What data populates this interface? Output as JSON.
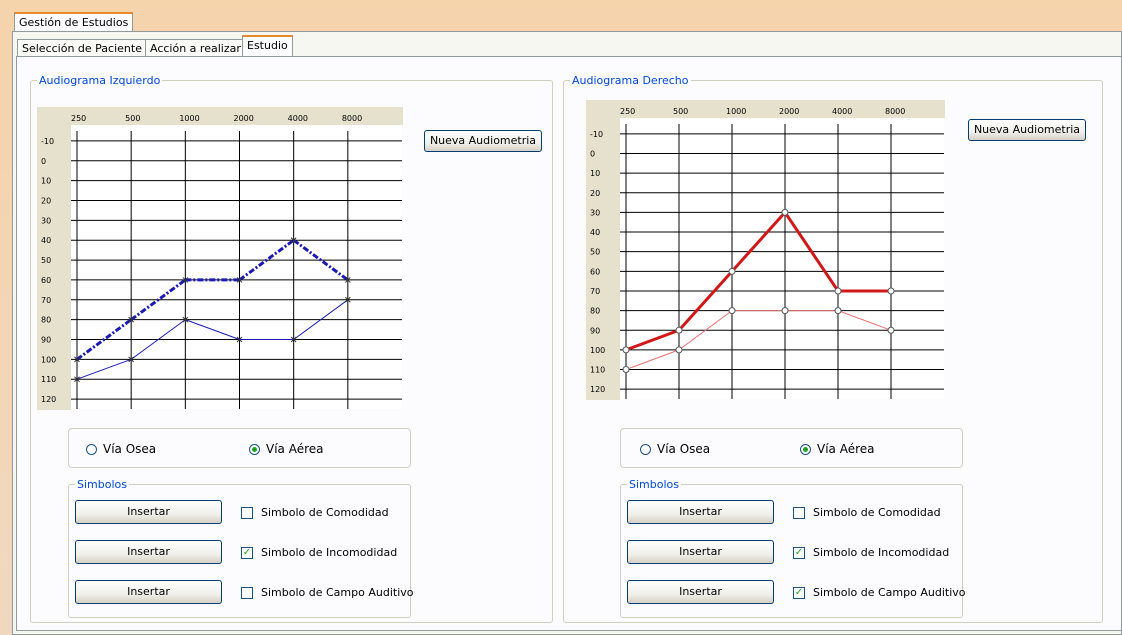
{
  "window": {
    "title": "Gestión de Estudios"
  },
  "tabs": [
    {
      "label": "Selección de Paciente"
    },
    {
      "label": "Acción a realizar"
    },
    {
      "label": "Estudio",
      "active": true
    }
  ],
  "left": {
    "group_title": "Audiograma Izquierdo",
    "new_button": "Nueva Audiometria",
    "radio_osea": "Vía Osea",
    "radio_aerea": "Vía Aérea",
    "selected_via": "aerea",
    "symbols_title": "Simbolos",
    "symbols": [
      {
        "button": "Insertar",
        "label": "Simbolo de Comodidad",
        "checked": false
      },
      {
        "button": "Insertar",
        "label": "Simbolo de Incomodidad",
        "checked": true
      },
      {
        "button": "Insertar",
        "label": "Simbolo de Campo Auditivo",
        "checked": false
      }
    ]
  },
  "right": {
    "group_title": "Audiograma Derecho",
    "new_button": "Nueva Audiometria",
    "radio_osea": "Vía Osea",
    "radio_aerea": "Vía Aérea",
    "selected_via": "aerea",
    "symbols_title": "Simbolos",
    "symbols": [
      {
        "button": "Insertar",
        "label": "Simbolo de Comodidad",
        "checked": false
      },
      {
        "button": "Insertar",
        "label": "Simbolo de Incomodidad",
        "checked": true
      },
      {
        "button": "Insertar",
        "label": "Simbolo de Campo Auditivo",
        "checked": true
      }
    ]
  },
  "colors": {
    "left_series": "#1a1ab3",
    "right_series": "#d01818",
    "accent_tab": "#e68b2c",
    "legend_text": "#0046d5"
  },
  "chart_data": [
    {
      "type": "line",
      "title": "Audiograma Izquierdo",
      "x": [
        250,
        500,
        1000,
        2000,
        4000,
        8000
      ],
      "x_tick_labels": [
        "250",
        "500",
        "1000",
        "2000",
        "4000",
        "8000"
      ],
      "y_tick_labels": [
        "-10",
        "0",
        "10",
        "20",
        "30",
        "40",
        "50",
        "60",
        "70",
        "80",
        "90",
        "100",
        "110",
        "120"
      ],
      "ylim": [
        -10,
        120
      ],
      "y_inverted": true,
      "series": [
        {
          "values": [
            100,
            80,
            60,
            60,
            40,
            60
          ],
          "style": "dash-dot-bold",
          "marker": "x"
        },
        {
          "values": [
            110,
            100,
            80,
            90,
            90,
            70
          ],
          "style": "thin",
          "marker": "x"
        }
      ]
    },
    {
      "type": "line",
      "title": "Audiograma Derecho",
      "x": [
        250,
        500,
        1000,
        2000,
        4000,
        8000
      ],
      "x_tick_labels": [
        "250",
        "500",
        "1000",
        "2000",
        "4000",
        "8000"
      ],
      "y_tick_labels": [
        "-10",
        "0",
        "10",
        "20",
        "30",
        "40",
        "50",
        "60",
        "70",
        "80",
        "90",
        "100",
        "110",
        "120"
      ],
      "ylim": [
        -10,
        120
      ],
      "y_inverted": true,
      "series": [
        {
          "values": [
            100,
            90,
            60,
            30,
            70,
            70
          ],
          "style": "bold",
          "marker": "o",
          "gap_after_index": null
        },
        {
          "values": [
            110,
            100,
            80,
            80,
            80,
            90
          ],
          "style": "thin",
          "marker": "o"
        }
      ]
    }
  ]
}
